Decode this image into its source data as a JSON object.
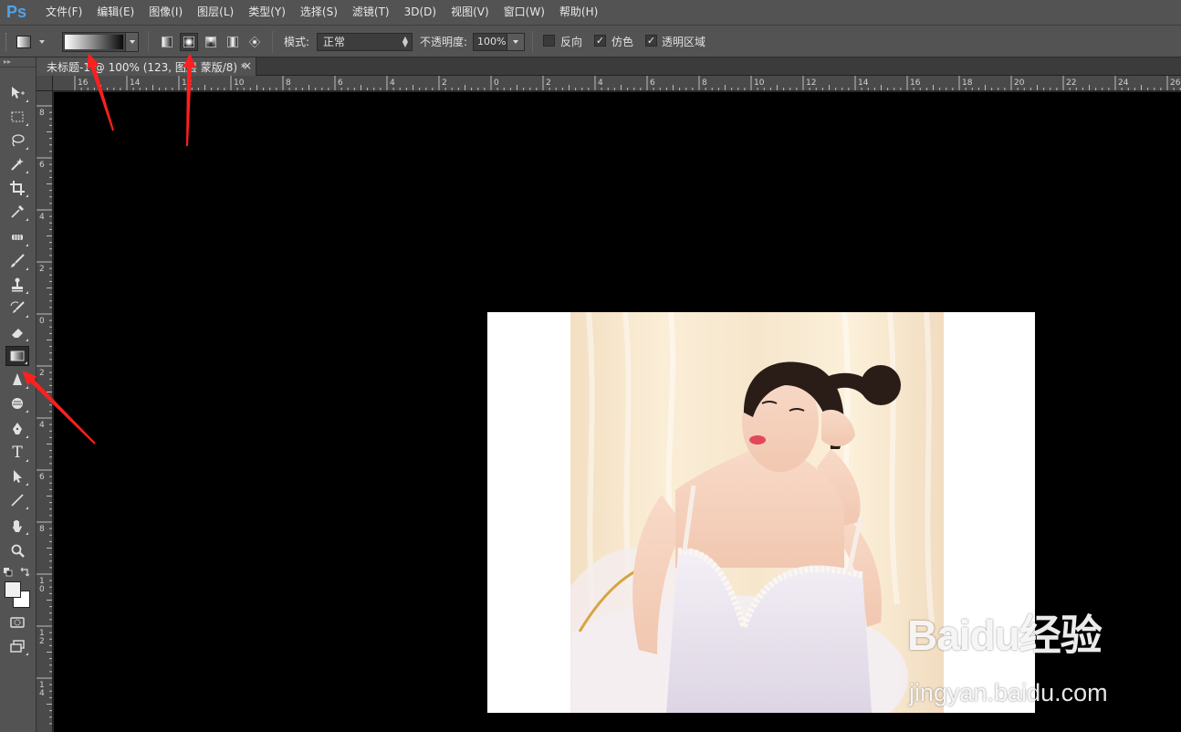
{
  "app": {
    "logo": "Ps"
  },
  "menu": [
    "文件(F)",
    "编辑(E)",
    "图像(I)",
    "图层(L)",
    "类型(Y)",
    "选择(S)",
    "滤镜(T)",
    "3D(D)",
    "视图(V)",
    "窗口(W)",
    "帮助(H)"
  ],
  "options": {
    "mode_label": "模式:",
    "mode_value": "正常",
    "opacity_label": "不透明度:",
    "opacity_value": "100%",
    "reverse_label": "反向",
    "reverse_checked": false,
    "dither_label": "仿色",
    "dither_checked": true,
    "transparency_label": "透明区域",
    "transparency_checked": true,
    "gradient_types": [
      "linear",
      "radial",
      "angle",
      "reflected",
      "diamond"
    ],
    "active_gradient_type": "radial",
    "gradient_colors": [
      "#ffffff",
      "#0a0a0a"
    ]
  },
  "document": {
    "tab_title": "未标题-1 @ 100% (123, 图层 蒙版/8) *",
    "close_glyph": "×"
  },
  "rulers": {
    "h_labels": [
      "16",
      "14",
      "12",
      "10",
      "8",
      "6",
      "4",
      "2",
      "0",
      "2",
      "4",
      "6",
      "8",
      "10",
      "12",
      "14",
      "16",
      "18",
      "20",
      "22",
      "24",
      "26"
    ],
    "v_labels": [
      "8",
      "6",
      "4",
      "2",
      "0",
      "2",
      "4",
      "6",
      "8",
      "10",
      "12",
      "14"
    ]
  },
  "toolbox": {
    "tools": [
      "move-icon",
      "marquee-icon",
      "lasso-icon",
      "magic-wand-icon",
      "crop-icon",
      "eyedropper-icon",
      "healing-brush-icon",
      "brush-icon",
      "clone-stamp-icon",
      "history-brush-icon",
      "eraser-icon",
      "gradient-icon",
      "blur-icon",
      "dodge-icon",
      "pen-icon",
      "type-icon",
      "path-selection-icon",
      "line-icon",
      "hand-icon",
      "zoom-icon"
    ],
    "active_tool": "gradient-icon",
    "type_glyph": "T",
    "foreground_color": "#f0f0f0",
    "background_color": "#ffffff"
  },
  "watermark": {
    "logo": "Baidu经验",
    "url": "jingyan.baidu.com"
  },
  "colors": {
    "arrow": "#ff1f1f",
    "accent": "#4fa3e8"
  }
}
